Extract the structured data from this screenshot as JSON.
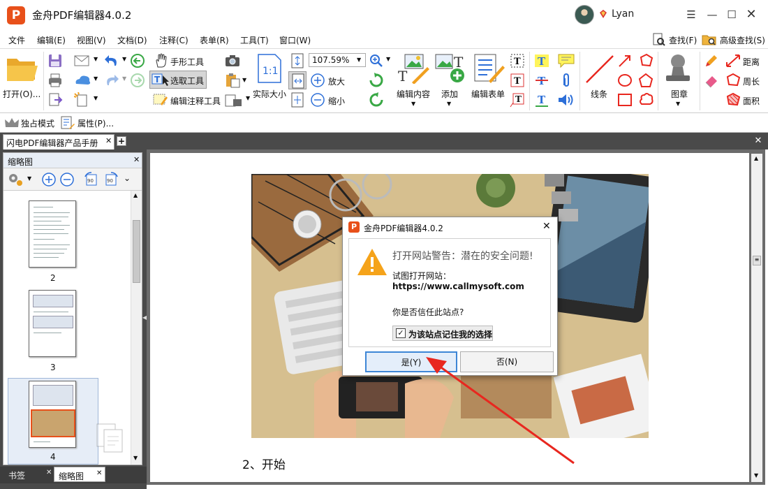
{
  "app": {
    "title": "金舟PDF编辑器4.0.2",
    "logo": "P",
    "user": "Lyan",
    "window_controls": [
      "menu-icon",
      "minimize-icon",
      "maximize-icon",
      "close-icon"
    ]
  },
  "menu": {
    "items": [
      "文件",
      "编辑(E)",
      "视图(V)",
      "文档(D)",
      "注释(C)",
      "表单(R)",
      "工具(T)",
      "窗口(W)"
    ],
    "find": "查找(F)",
    "advanced_find": "高级查找(S)"
  },
  "ribbon": {
    "open": "打开(O)...",
    "hand_tool": "手形工具",
    "select_tool": "选取工具",
    "edit_annot_tool": "编辑注释工具",
    "actual_size": "实际大小",
    "zoom_value": "107.59%",
    "zoom_in": "放大",
    "zoom_out": "缩小",
    "edit_content": "编辑内容",
    "add": "添加",
    "edit_form": "编辑表单",
    "lines": "线条",
    "stamp": "图章",
    "distance": "距离",
    "perimeter": "周长",
    "area": "面积"
  },
  "toolbar2": {
    "exclusive_mode": "独占模式",
    "properties": "属性(P)..."
  },
  "tabs": {
    "doc_tab": "闪电PDF编辑器产品手册"
  },
  "left_panel": {
    "title": "缩略图",
    "thumbnails": [
      {
        "page": "2"
      },
      {
        "page": "3"
      },
      {
        "page": "4"
      }
    ],
    "bottom_tabs": [
      "书签",
      "缩略图"
    ]
  },
  "document": {
    "section_heading": "2、开始"
  },
  "dialog": {
    "title": "金舟PDF编辑器4.0.2",
    "heading": "打开网站警告：潜在的安全问题!",
    "line1": "试图打开网站：",
    "url": "https://www.callmysoft.com",
    "question": "你是否信任此站点?",
    "remember_label": "为该站点记住我的选择",
    "remember_checked": true,
    "yes_label": "是(Y)",
    "no_label": "否(N)"
  },
  "colors": {
    "accent": "#e8501a",
    "annotation_arrow": "#e8271f",
    "viewer_bg": "#6b6b6b"
  }
}
